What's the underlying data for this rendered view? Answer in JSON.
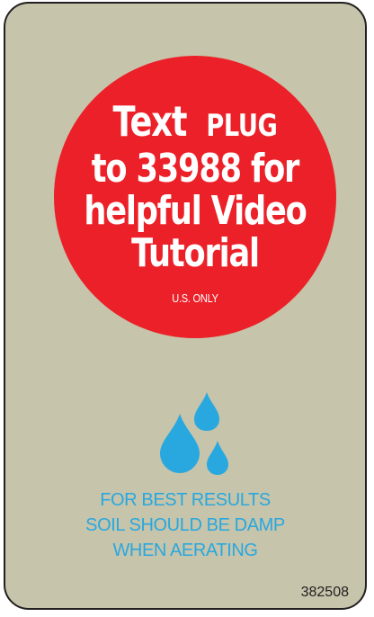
{
  "promo": {
    "word_text": "Text",
    "keyword": "PLUG",
    "line2": "to 33988 for",
    "line3": "helpful Video",
    "line4": "Tutorial",
    "region_note": "U.S. ONLY"
  },
  "tip": {
    "line1": "FOR BEST RESULTS",
    "line2": "SOIL SHOULD BE DAMP",
    "line3": "WHEN AERATING"
  },
  "part_number": "382508",
  "icons": {
    "water": "water-drops-icon"
  },
  "colors": {
    "background": "#c6c4aa",
    "circle": "#ec2028",
    "accent": "#29a8df",
    "border": "#231f20"
  }
}
